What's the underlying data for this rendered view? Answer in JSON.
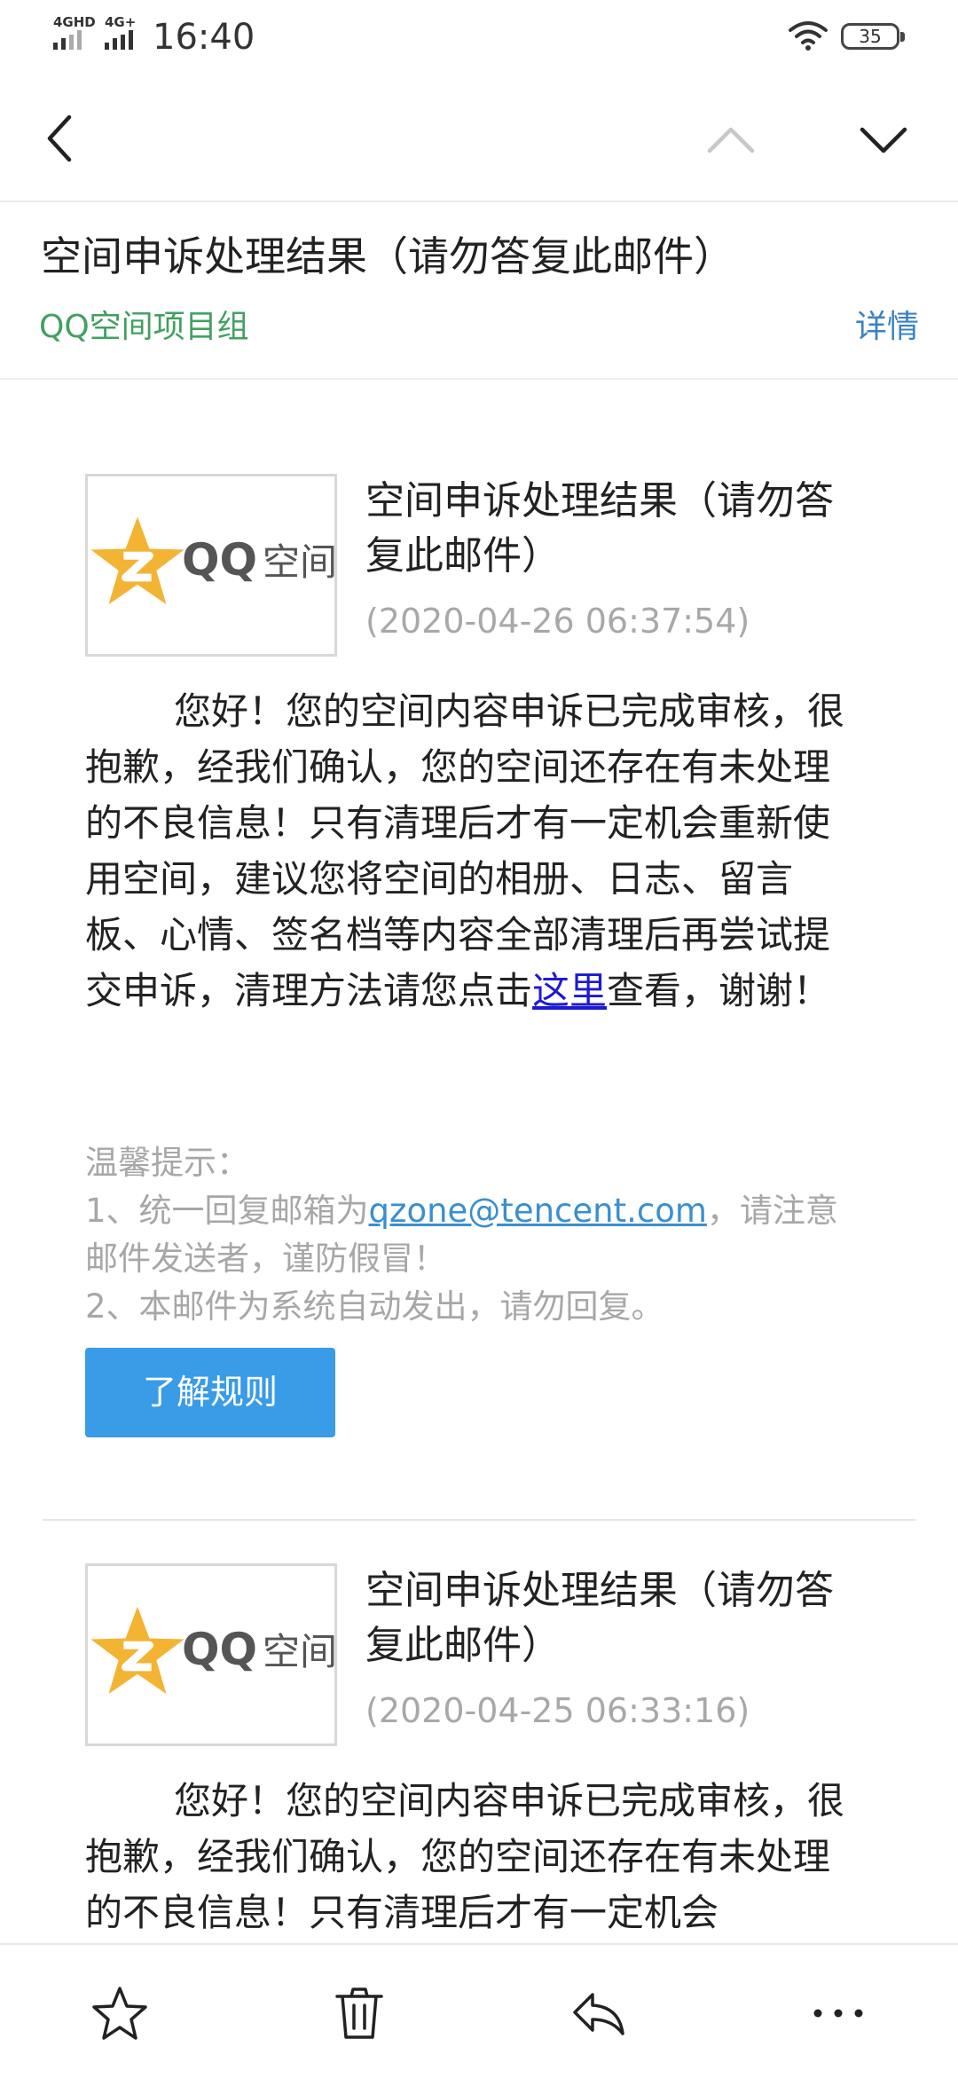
{
  "status_bar": {
    "net1": "4GHD",
    "net2": "4G+",
    "time": "16:40",
    "battery": "35"
  },
  "nav": {
    "back_icon": "chevron-left-icon",
    "prev_icon": "chevron-up-icon",
    "next_icon": "chevron-down-icon"
  },
  "header": {
    "subject": "空间申诉处理结果（请勿答复此邮件）",
    "sender": "QQ空间项目组",
    "details": "详情"
  },
  "messages": [
    {
      "logo_text": "QQ",
      "logo_sub": "空间",
      "title": "空间申诉处理结果（请勿答复此邮件）",
      "date": "(2020-04-26 06:37:54)",
      "body": "您好！您的空间内容申诉已完成审核，很抱歉，经我们确认，您的空间还存在有未处理的不良信息！只有清理后才有一定机会重新使用空间，建议您将空间的相册、日志、留言板、心情、签名档等内容全部清理后再尝试提交申诉，清理方法请您点击",
      "link": "这里",
      "body_end": "查看，谢谢！",
      "tips_title": "温馨提示：",
      "tip1_pre": "1、统一回复邮箱为",
      "tip1_email": "qzone@tencent.com",
      "tip1_post": "，请注意邮件发送者，谨防假冒！",
      "tip2": "2、本邮件为系统自动发出，请勿回复。",
      "button": "了解规则"
    },
    {
      "logo_text": "QQ",
      "logo_sub": "空间",
      "title": "空间申诉处理结果（请勿答复此邮件）",
      "date": "(2020-04-25 06:33:16)",
      "body": "您好！您的空间内容申诉已完成审核，很抱歉，经我们确认，您的空间还存在有未处理的不良信息！只有清理后才有一定机会"
    }
  ],
  "bottom_bar": {
    "icons": [
      "star-icon",
      "trash-icon",
      "reply-icon",
      "more-icon"
    ]
  },
  "colors": {
    "sender": "#43a062",
    "details": "#3a82c4",
    "button": "#3a9be6",
    "link": "#1d1bd0",
    "muted": "#a7a7a7",
    "logo_star": "#f3b433"
  }
}
